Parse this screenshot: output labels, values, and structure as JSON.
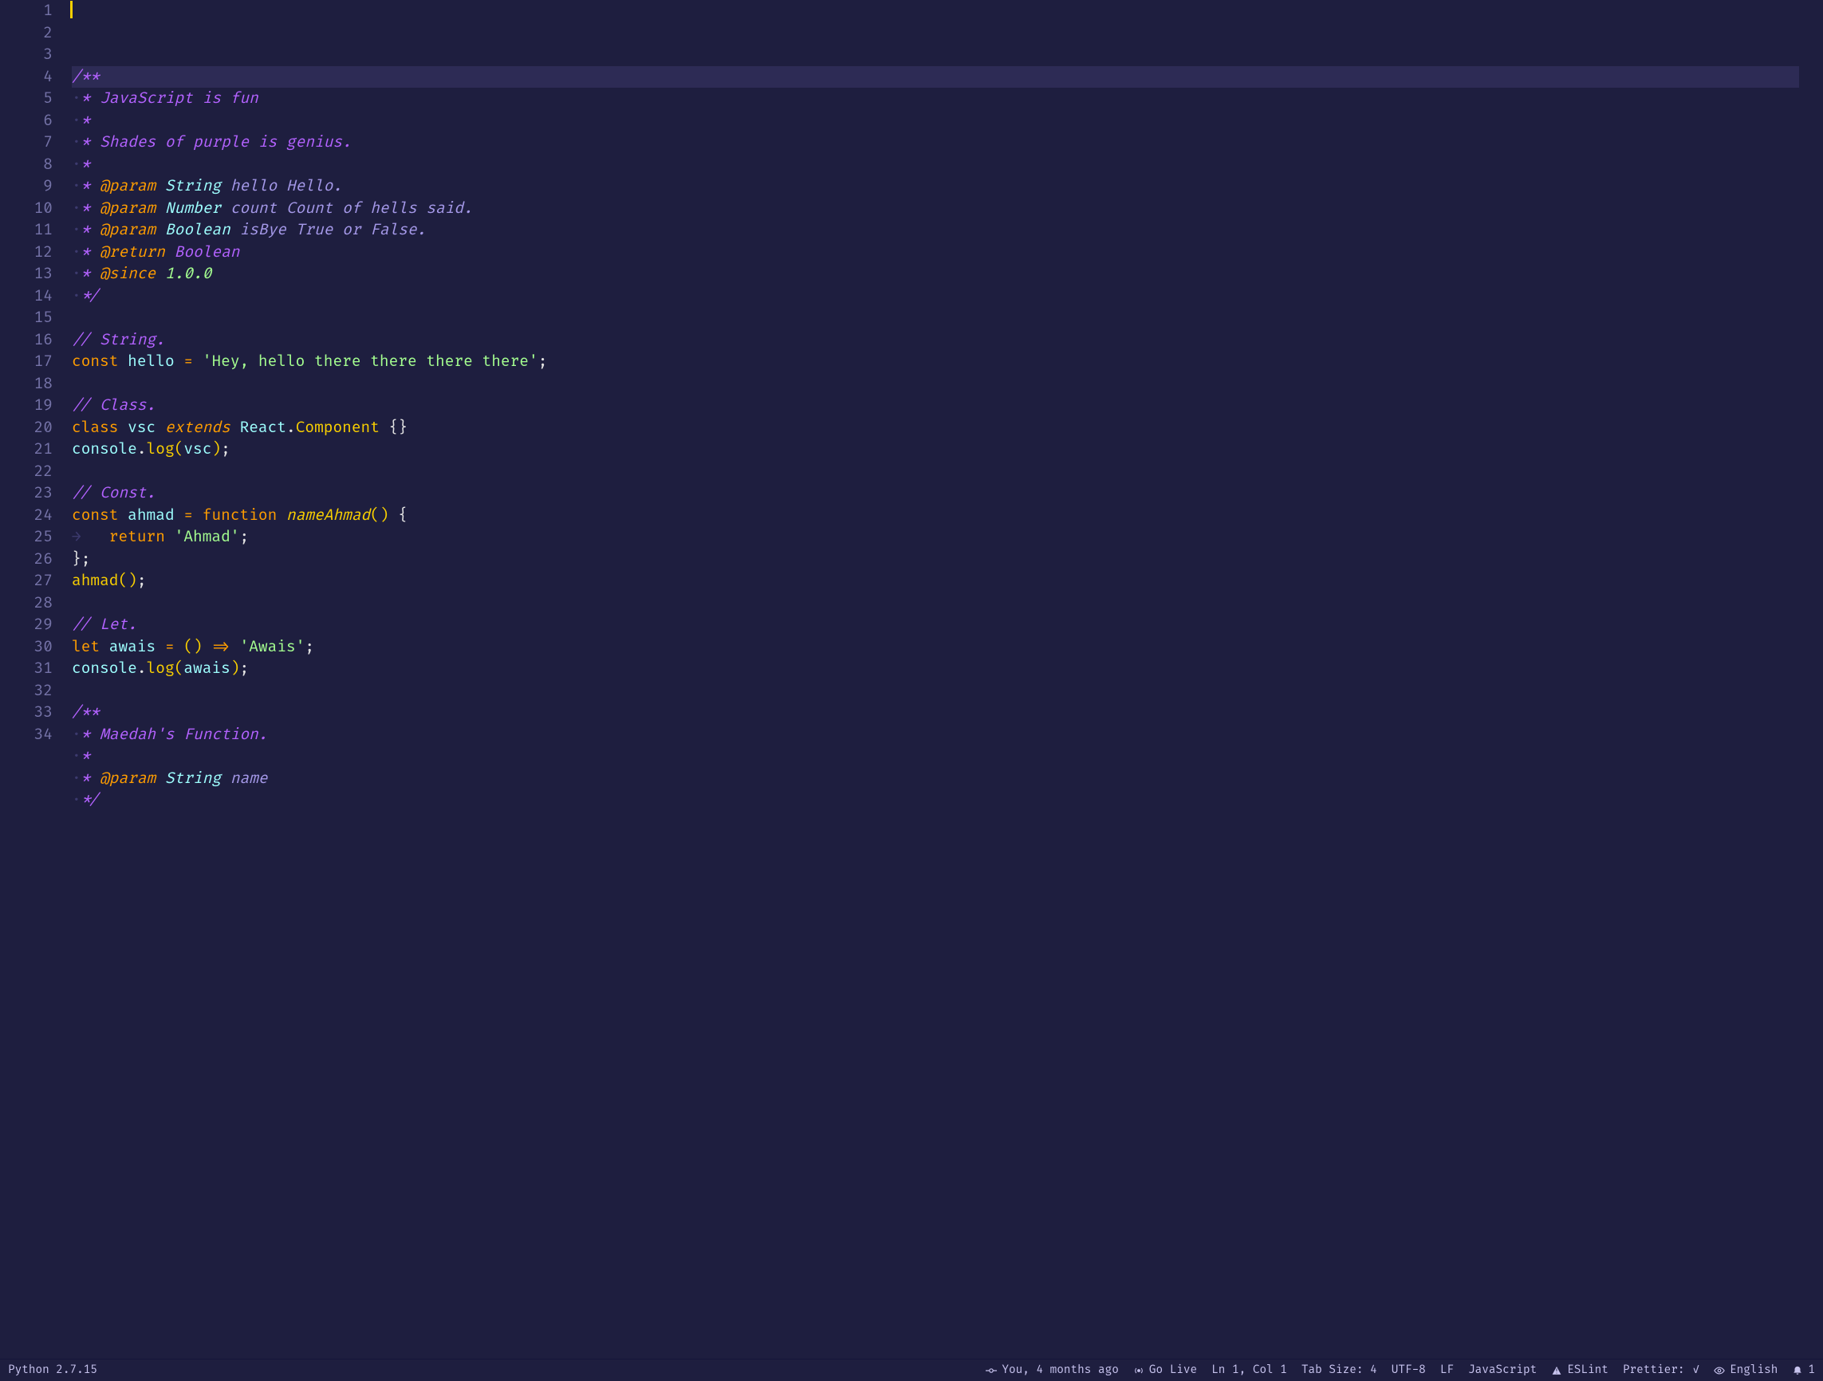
{
  "lineCount": 34,
  "currentLine": 1,
  "code": {
    "l1": [
      {
        "t": "/**",
        "c": "c-comment"
      }
    ],
    "l2": [
      {
        "t": "·",
        "c": "ws"
      },
      {
        "t": "* JavaScript is fun",
        "c": "c-comment"
      }
    ],
    "l3": [
      {
        "t": "·",
        "c": "ws"
      },
      {
        "t": "*",
        "c": "c-comment"
      }
    ],
    "l4": [
      {
        "t": "·",
        "c": "ws"
      },
      {
        "t": "* Shades of purple is genius.",
        "c": "c-comment"
      }
    ],
    "l5": [
      {
        "t": "·",
        "c": "ws"
      },
      {
        "t": "*",
        "c": "c-comment"
      }
    ],
    "l6": [
      {
        "t": "·",
        "c": "ws"
      },
      {
        "t": "* ",
        "c": "c-comment"
      },
      {
        "t": "@param",
        "c": "c-doctag"
      },
      {
        "t": " ",
        "c": "c-comment"
      },
      {
        "t": "String",
        "c": "c-type"
      },
      {
        "t": " ",
        "c": "c-comment"
      },
      {
        "t": "hello",
        "c": "c-docvar"
      },
      {
        "t": " Hello.",
        "c": "c-docdesc"
      }
    ],
    "l7": [
      {
        "t": "·",
        "c": "ws"
      },
      {
        "t": "* ",
        "c": "c-comment"
      },
      {
        "t": "@param",
        "c": "c-doctag"
      },
      {
        "t": " ",
        "c": "c-comment"
      },
      {
        "t": "Number",
        "c": "c-type"
      },
      {
        "t": " ",
        "c": "c-comment"
      },
      {
        "t": "count",
        "c": "c-docvar"
      },
      {
        "t": " Count of hells said.",
        "c": "c-docdesc"
      }
    ],
    "l8": [
      {
        "t": "·",
        "c": "ws"
      },
      {
        "t": "* ",
        "c": "c-comment"
      },
      {
        "t": "@param",
        "c": "c-doctag"
      },
      {
        "t": " ",
        "c": "c-comment"
      },
      {
        "t": "Boolean",
        "c": "c-type"
      },
      {
        "t": " ",
        "c": "c-comment"
      },
      {
        "t": "isBye",
        "c": "c-docvar"
      },
      {
        "t": " True or False.",
        "c": "c-docdesc"
      }
    ],
    "l9": [
      {
        "t": "·",
        "c": "ws"
      },
      {
        "t": "* ",
        "c": "c-comment"
      },
      {
        "t": "@return",
        "c": "c-doctag"
      },
      {
        "t": " ",
        "c": "c-comment"
      },
      {
        "t": "Boolean",
        "c": "c-comment"
      }
    ],
    "l10": [
      {
        "t": "·",
        "c": "ws"
      },
      {
        "t": "* ",
        "c": "c-comment"
      },
      {
        "t": "@since",
        "c": "c-doctag"
      },
      {
        "t": " ",
        "c": "c-comment"
      },
      {
        "t": "1.0.0",
        "c": "c-version"
      }
    ],
    "l11": [
      {
        "t": "·",
        "c": "ws"
      },
      {
        "t": "*/",
        "c": "c-comment"
      }
    ],
    "l12": [],
    "l13": [
      {
        "t": "// String.",
        "c": "c-comment"
      }
    ],
    "l14": [
      {
        "t": "const",
        "c": "c-kw"
      },
      {
        "t": " ",
        "c": ""
      },
      {
        "t": "hello",
        "c": "c-var"
      },
      {
        "t": " ",
        "c": ""
      },
      {
        "t": "=",
        "c": "c-op"
      },
      {
        "t": " ",
        "c": ""
      },
      {
        "t": "'Hey, hello there there there there'",
        "c": "c-str"
      },
      {
        "t": ";",
        "c": "c-punc"
      }
    ],
    "l15": [],
    "l16": [
      {
        "t": "// Class.",
        "c": "c-comment"
      }
    ],
    "l17": [
      {
        "t": "class",
        "c": "c-kw"
      },
      {
        "t": " ",
        "c": ""
      },
      {
        "t": "vsc",
        "c": "c-var"
      },
      {
        "t": " ",
        "c": ""
      },
      {
        "t": "extends",
        "c": "c-kw-i"
      },
      {
        "t": " ",
        "c": ""
      },
      {
        "t": "React",
        "c": "c-obj"
      },
      {
        "t": ".",
        "c": "c-punc"
      },
      {
        "t": "Component",
        "c": "c-func"
      },
      {
        "t": " ",
        "c": ""
      },
      {
        "t": "{}",
        "c": "c-punc"
      }
    ],
    "l18": [
      {
        "t": "console",
        "c": "c-obj"
      },
      {
        "t": ".",
        "c": "c-punc"
      },
      {
        "t": "log",
        "c": "c-func"
      },
      {
        "t": "(",
        "c": "c-paren"
      },
      {
        "t": "vsc",
        "c": "c-var"
      },
      {
        "t": ")",
        "c": "c-paren"
      },
      {
        "t": ";",
        "c": "c-punc"
      }
    ],
    "l19": [],
    "l20": [
      {
        "t": "// Const.",
        "c": "c-comment"
      }
    ],
    "l21": [
      {
        "t": "const",
        "c": "c-kw"
      },
      {
        "t": " ",
        "c": ""
      },
      {
        "t": "ahmad",
        "c": "c-var"
      },
      {
        "t": " ",
        "c": ""
      },
      {
        "t": "=",
        "c": "c-op"
      },
      {
        "t": " ",
        "c": ""
      },
      {
        "t": "function",
        "c": "c-kw"
      },
      {
        "t": " ",
        "c": ""
      },
      {
        "t": "nameAhmad",
        "c": "c-fn-i"
      },
      {
        "t": "()",
        "c": "c-paren"
      },
      {
        "t": " ",
        "c": ""
      },
      {
        "t": "{",
        "c": "c-punc"
      }
    ],
    "l22": [
      {
        "t": "→   ",
        "c": "ws"
      },
      {
        "t": "return",
        "c": "c-kw"
      },
      {
        "t": " ",
        "c": ""
      },
      {
        "t": "'Ahmad'",
        "c": "c-str"
      },
      {
        "t": ";",
        "c": "c-punc"
      }
    ],
    "l23": [
      {
        "t": "}",
        "c": "c-punc"
      },
      {
        "t": ";",
        "c": "c-punc"
      }
    ],
    "l24": [
      {
        "t": "ahmad",
        "c": "c-func"
      },
      {
        "t": "()",
        "c": "c-paren"
      },
      {
        "t": ";",
        "c": "c-punc"
      }
    ],
    "l25": [],
    "l26": [
      {
        "t": "// Let.",
        "c": "c-comment"
      }
    ],
    "l27": [
      {
        "t": "let",
        "c": "c-kw"
      },
      {
        "t": " ",
        "c": ""
      },
      {
        "t": "awais",
        "c": "c-var"
      },
      {
        "t": " ",
        "c": ""
      },
      {
        "t": "=",
        "c": "c-op"
      },
      {
        "t": " ",
        "c": ""
      },
      {
        "t": "()",
        "c": "c-paren"
      },
      {
        "t": " ",
        "c": ""
      },
      {
        "t": "=>",
        "c": "c-op"
      },
      {
        "t": " ",
        "c": ""
      },
      {
        "t": "'Awais'",
        "c": "c-str"
      },
      {
        "t": ";",
        "c": "c-punc"
      }
    ],
    "l28": [
      {
        "t": "console",
        "c": "c-obj"
      },
      {
        "t": ".",
        "c": "c-punc"
      },
      {
        "t": "log",
        "c": "c-func"
      },
      {
        "t": "(",
        "c": "c-paren"
      },
      {
        "t": "awais",
        "c": "c-var"
      },
      {
        "t": ")",
        "c": "c-paren"
      },
      {
        "t": ";",
        "c": "c-punc"
      }
    ],
    "l29": [],
    "l30": [
      {
        "t": "/**",
        "c": "c-comment"
      }
    ],
    "l31": [
      {
        "t": "·",
        "c": "ws"
      },
      {
        "t": "* Maedah's Function.",
        "c": "c-comment"
      }
    ],
    "l32": [
      {
        "t": "·",
        "c": "ws"
      },
      {
        "t": "*",
        "c": "c-comment"
      }
    ],
    "l33": [
      {
        "t": "·",
        "c": "ws"
      },
      {
        "t": "* ",
        "c": "c-comment"
      },
      {
        "t": "@param",
        "c": "c-doctag"
      },
      {
        "t": " ",
        "c": "c-comment"
      },
      {
        "t": "String",
        "c": "c-type"
      },
      {
        "t": " ",
        "c": "c-comment"
      },
      {
        "t": "name",
        "c": "c-docvar"
      }
    ],
    "l34": [
      {
        "t": "·",
        "c": "ws"
      },
      {
        "t": "*/",
        "c": "c-comment"
      }
    ]
  },
  "status": {
    "python": "Python 2.7.15",
    "blame": "You, 4 months ago",
    "goLive": "Go Live",
    "position": "Ln 1, Col 1",
    "tabSize": "Tab Size: 4",
    "encoding": "UTF-8",
    "eol": "LF",
    "language": "JavaScript",
    "eslint": "ESLint",
    "prettier": "Prettier:",
    "spell": "English",
    "bellCount": "1"
  }
}
